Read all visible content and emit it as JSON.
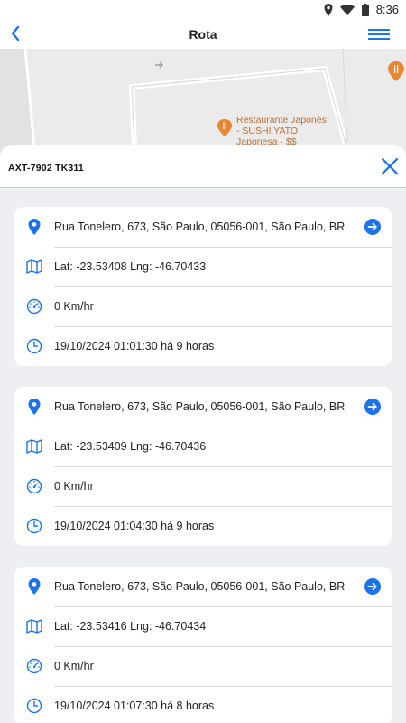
{
  "status_bar": {
    "time": "8:36"
  },
  "app_bar": {
    "title": "Rota"
  },
  "map": {
    "poi_label_line1": "Restaurante Japonês",
    "poi_label_line2": "- SUSHI YATO",
    "poi_label_line3": "Japonesa · $$"
  },
  "sheet": {
    "title": "AXT-7902 TK311"
  },
  "positions": [
    {
      "address": "Rua Tonelero, 673, São Paulo, 05056-001, São Paulo, BR",
      "coords": "Lat: -23.53408 Lng: -46.70433",
      "speed": "0 Km/hr",
      "time": "19/10/2024 01:01:30  há 9 horas"
    },
    {
      "address": "Rua Tonelero, 673, São Paulo, 05056-001, São Paulo, BR",
      "coords": "Lat: -23.53409 Lng: -46.70436",
      "speed": "0 Km/hr",
      "time": "19/10/2024 01:04:30  há 9 horas"
    },
    {
      "address": "Rua Tonelero, 673, São Paulo, 05056-001, São Paulo, BR",
      "coords": "Lat: -23.53416 Lng: -46.70434",
      "speed": "0 Km/hr",
      "time": "19/10/2024 01:07:30  há 8 horas"
    }
  ],
  "icons": {
    "address": "map-pin-icon",
    "coords": "map-icon",
    "speed": "speedometer-icon",
    "time": "clock-icon",
    "go": "arrow-right-circle-icon"
  },
  "colors": {
    "accent": "#1a73e8",
    "sheet_bg": "#eeeff2",
    "map_bg": "#ebebeb"
  }
}
